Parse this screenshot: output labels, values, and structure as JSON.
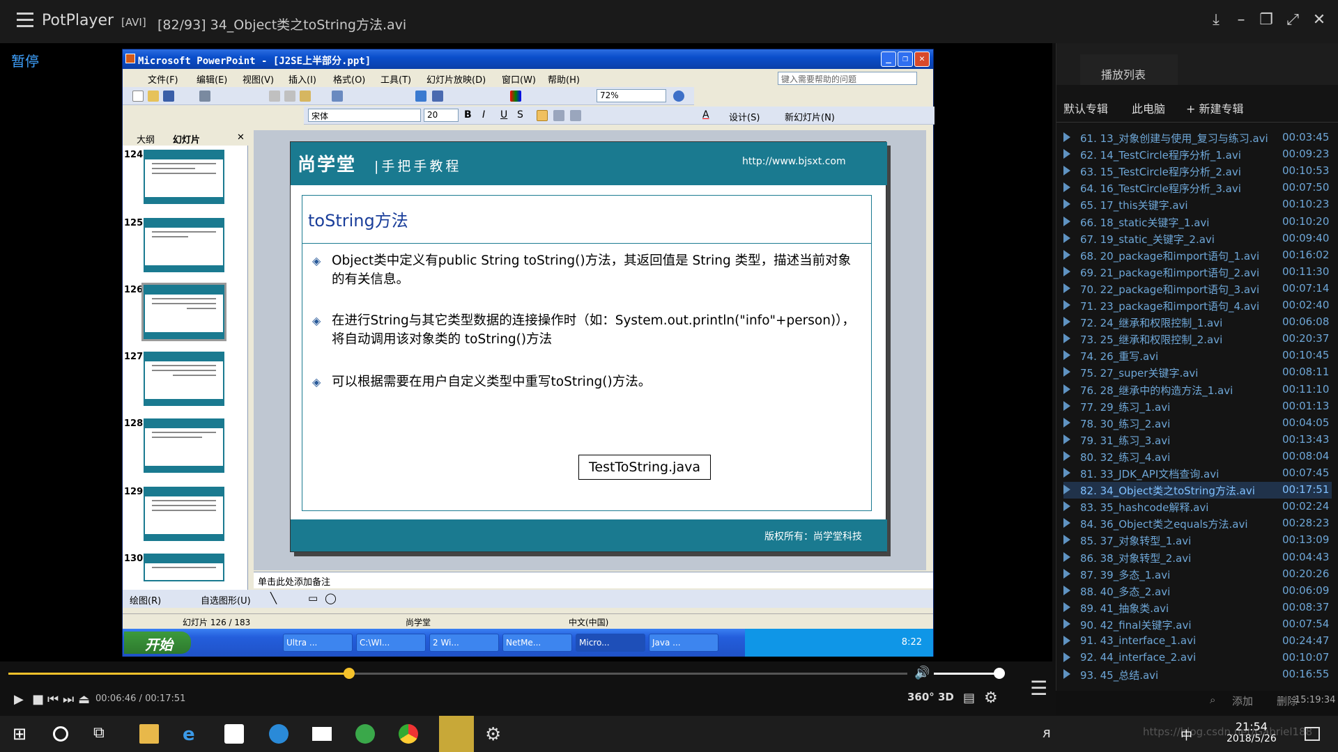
{
  "player": {
    "app_name": "PotPlayer",
    "format": "[AVI]",
    "file_title": "[82/93] 34_Object类之toString方法.avi",
    "pause_label": "暂停",
    "time_current": "00:06:46",
    "time_sep": "/",
    "time_total": "00:17:51",
    "progress_fraction": 0.379,
    "volume_fraction": 1.0,
    "btn_360": "360°",
    "btn_3d": "3D"
  },
  "ppt": {
    "title": "Microsoft PowerPoint - [J2SE上半部分.ppt]",
    "menu": [
      "文件(F)",
      "编辑(E)",
      "视图(V)",
      "插入(I)",
      "格式(O)",
      "工具(T)",
      "幻灯片放映(D)",
      "窗口(W)",
      "帮助(H)"
    ],
    "help_placeholder": "键入需要帮助的问题",
    "zoom": "72%",
    "font_name": "宋体",
    "font_size": "20",
    "design_label": "设计(S)",
    "new_slide_label": "新幻灯片(N)",
    "tab_outline": "大纲",
    "tab_slides": "幻灯片",
    "thumb_numbers": [
      "124",
      "125",
      "126",
      "127",
      "128",
      "129",
      "130"
    ],
    "notes_placeholder": "单击此处添加备注",
    "draw_label": "绘图(R)",
    "autoshape_label": "自选图形(U)",
    "status_slide": "幻灯片 126 / 183",
    "status_design": "尚学堂",
    "status_lang": "中文(中国)"
  },
  "slide": {
    "logo": "尚学堂",
    "tagline": "|手把手教程",
    "url": "http://www.bjsxt.com",
    "heading": "toString方法",
    "bullets": [
      "Object类中定义有public String toString()方法，其返回值是 String 类型，描述当前对象的有关信息。",
      "在进行String与其它类型数据的连接操作时（如：System.out.println(\"info\"+person)），将自动调用该对象类的 toString()方法",
      "可以根据需要在用户自定义类型中重写toString()方法。"
    ],
    "file_box": "TestToString.java",
    "copyright": "版权所有：尚学堂科技"
  },
  "xp_taskbar": {
    "start": "开始",
    "buttons": [
      "Ultra ...",
      "C:\\WI...",
      "2 Wi...",
      "NetMe...",
      "Micro...",
      "Java ..."
    ],
    "clock": "8:22"
  },
  "playlist": {
    "tab_title": "播放列表",
    "tabs": [
      "默认专辑",
      "此电脑",
      "+ 新建专辑"
    ],
    "items": [
      {
        "name": "61. 13_对象创建与使用_复习与练习.avi",
        "dur": "00:03:45"
      },
      {
        "name": "62. 14_TestCircle程序分析_1.avi",
        "dur": "00:09:23"
      },
      {
        "name": "63. 15_TestCircle程序分析_2.avi",
        "dur": "00:10:53"
      },
      {
        "name": "64. 16_TestCircle程序分析_3.avi",
        "dur": "00:07:50"
      },
      {
        "name": "65. 17_this关键字.avi",
        "dur": "00:10:23"
      },
      {
        "name": "66. 18_static关键字_1.avi",
        "dur": "00:10:20"
      },
      {
        "name": "67. 19_static_关键字_2.avi",
        "dur": "00:09:40"
      },
      {
        "name": "68. 20_package和import语句_1.avi",
        "dur": "00:16:02"
      },
      {
        "name": "69. 21_package和import语句_2.avi",
        "dur": "00:11:30"
      },
      {
        "name": "70. 22_package和import语句_3.avi",
        "dur": "00:07:14"
      },
      {
        "name": "71. 23_package和import语句_4.avi",
        "dur": "00:02:40"
      },
      {
        "name": "72. 24_继承和权限控制_1.avi",
        "dur": "00:06:08"
      },
      {
        "name": "73. 25_继承和权限控制_2.avi",
        "dur": "00:20:37"
      },
      {
        "name": "74. 26_重写.avi",
        "dur": "00:10:45"
      },
      {
        "name": "75. 27_super关键字.avi",
        "dur": "00:08:11"
      },
      {
        "name": "76. 28_继承中的构造方法_1.avi",
        "dur": "00:11:10"
      },
      {
        "name": "77. 29_练习_1.avi",
        "dur": "00:01:13"
      },
      {
        "name": "78. 30_练习_2.avi",
        "dur": "00:04:05"
      },
      {
        "name": "79. 31_练习_3.avi",
        "dur": "00:13:43"
      },
      {
        "name": "80. 32_练习_4.avi",
        "dur": "00:08:04"
      },
      {
        "name": "81. 33_JDK_API文档查询.avi",
        "dur": "00:07:45"
      },
      {
        "name": "82. 34_Object类之toString方法.avi",
        "dur": "00:17:51"
      },
      {
        "name": "83. 35_hashcode解释.avi",
        "dur": "00:02:24"
      },
      {
        "name": "84. 36_Object类之equals方法.avi",
        "dur": "00:28:23"
      },
      {
        "name": "85. 37_对象转型_1.avi",
        "dur": "00:13:09"
      },
      {
        "name": "86. 38_对象转型_2.avi",
        "dur": "00:04:43"
      },
      {
        "name": "87. 39_多态_1.avi",
        "dur": "00:20:26"
      },
      {
        "name": "88. 40_多态_2.avi",
        "dur": "00:06:09"
      },
      {
        "name": "89. 41_抽象类.avi",
        "dur": "00:08:37"
      },
      {
        "name": "90. 42_final关键字.avi",
        "dur": "00:07:54"
      },
      {
        "name": "91. 43_interface_1.avi",
        "dur": "00:24:47"
      },
      {
        "name": "92. 44_interface_2.avi",
        "dur": "00:10:07"
      },
      {
        "name": "93. 45_总结.avi",
        "dur": "00:16:55"
      }
    ],
    "current_index": 21,
    "add_label": "添加",
    "delete_label": "删除",
    "total_time": "15:19:34"
  },
  "win_taskbar": {
    "time": "21:54",
    "date": "2018/5/26",
    "ime": "中",
    "watermark": "https://blog.csdn.net/Gabriel188"
  }
}
